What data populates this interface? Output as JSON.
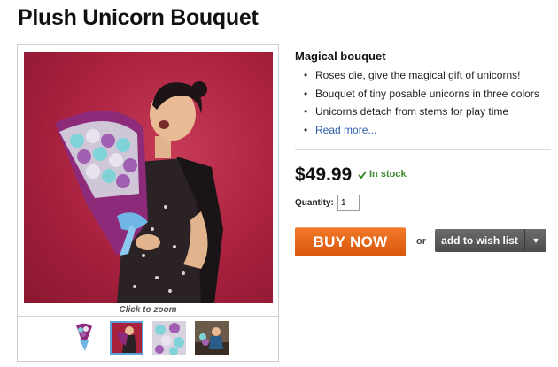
{
  "product": {
    "title": "Plush Unicorn Bouquet"
  },
  "gallery": {
    "zoom_caption": "Click to zoom",
    "selected_thumbnail": 2,
    "thumbnail_count": 4
  },
  "description": {
    "heading": "Magical bouquet",
    "features": [
      "Roses die, give the magical gift of unicorns!",
      "Bouquet of tiny posable unicorns in three colors",
      "Unicorns detach from stems for play time"
    ],
    "read_more": "Read more..."
  },
  "purchase": {
    "price": "$49.99",
    "stock_status": "In stock",
    "quantity_label": "Quantity:",
    "quantity_value": "1",
    "buy_label": "BUY NOW",
    "or_label": "or",
    "wishlist_label": "add to wish list"
  },
  "colors": {
    "photo_background": "#a8213d",
    "buy_button": "#e8661a",
    "wishlist_button": "#5a5a5a",
    "stock_green": "#3c8a2e",
    "link_blue": "#2b5da8"
  }
}
